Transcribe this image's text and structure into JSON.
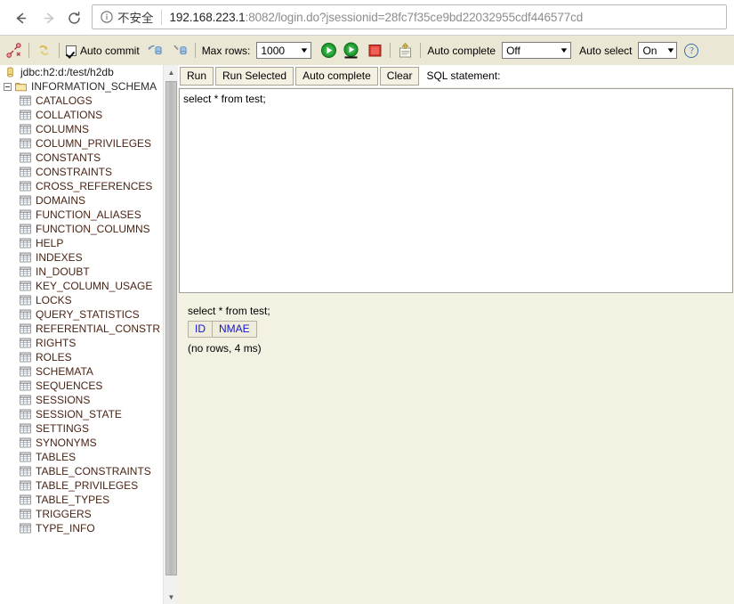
{
  "browser": {
    "back_icon": "arrow-left-icon",
    "forward_icon": "arrow-right-icon",
    "reload_icon": "reload-icon",
    "info_icon": "info-circle-icon",
    "security_label": "不安全",
    "url_host": "192.168.223.1",
    "url_rest": ":8082/login.do?jsessionid=28fc7f35ce9bd22032955cdf446577cd",
    "url_full": "192.168.223.1:8082/login.do?jsessionid=28fc7f35ce9bd22032955cdf446577cd"
  },
  "toolbar": {
    "disconnect_icon": "disconnect-icon",
    "refresh_icon": "refresh-icon",
    "auto_commit_label": "Auto commit",
    "auto_commit_checked": true,
    "commit_icon": "commit-icon",
    "rollback_icon": "rollback-icon",
    "max_rows_label": "Max rows:",
    "max_rows_value": "1000",
    "run_icon": "run-icon",
    "run_selected_icon": "run-selected-icon",
    "stop_icon": "stop-icon",
    "upload_icon": "upload-script-icon",
    "auto_complete_label": "Auto complete",
    "auto_complete_value": "Off",
    "auto_select_label": "Auto select",
    "auto_select_value": "On",
    "help_icon": "help-icon",
    "help_glyph": "?",
    "caret_glyph": "▼",
    "background_color": "#eae7d5"
  },
  "editor": {
    "buttons": [
      {
        "label": "Run",
        "name": "run-button"
      },
      {
        "label": "Run Selected",
        "name": "run-selected-button"
      },
      {
        "label": "Auto complete",
        "name": "auto-complete-button"
      },
      {
        "label": "Clear",
        "name": "clear-button"
      }
    ],
    "sql_statement_label": "SQL statement:",
    "sql_value": "select * from test;",
    "sql_placeholder": "SQL statement"
  },
  "result": {
    "query_echo": "select * from test;",
    "columns": [
      "ID",
      "NMAE"
    ],
    "rows": [],
    "status": "(no rows, 4 ms)",
    "column_color": "#1414cf",
    "background_color": "#f3f1e2"
  },
  "tree": {
    "root": {
      "label": "jdbc:h2:d:/test/h2db",
      "icon": "database-icon"
    },
    "schema": {
      "label": "INFORMATION_SCHEMA",
      "icon": "folder-icon",
      "expanded": true
    },
    "table_icon": "table-icon",
    "tables": [
      "CATALOGS",
      "COLLATIONS",
      "COLUMNS",
      "COLUMN_PRIVILEGES",
      "CONSTANTS",
      "CONSTRAINTS",
      "CROSS_REFERENCES",
      "DOMAINS",
      "FUNCTION_ALIASES",
      "FUNCTION_COLUMNS",
      "HELP",
      "INDEXES",
      "IN_DOUBT",
      "KEY_COLUMN_USAGE",
      "LOCKS",
      "QUERY_STATISTICS",
      "REFERENTIAL_CONSTR",
      "RIGHTS",
      "ROLES",
      "SCHEMATA",
      "SEQUENCES",
      "SESSIONS",
      "SESSION_STATE",
      "SETTINGS",
      "SYNONYMS",
      "TABLES",
      "TABLE_CONSTRAINTS",
      "TABLE_PRIVILEGES",
      "TABLE_TYPES",
      "TRIGGERS",
      "TYPE_INFO"
    ],
    "scrollbar": {
      "up_glyph": "▲",
      "down_glyph": "▼"
    }
  }
}
